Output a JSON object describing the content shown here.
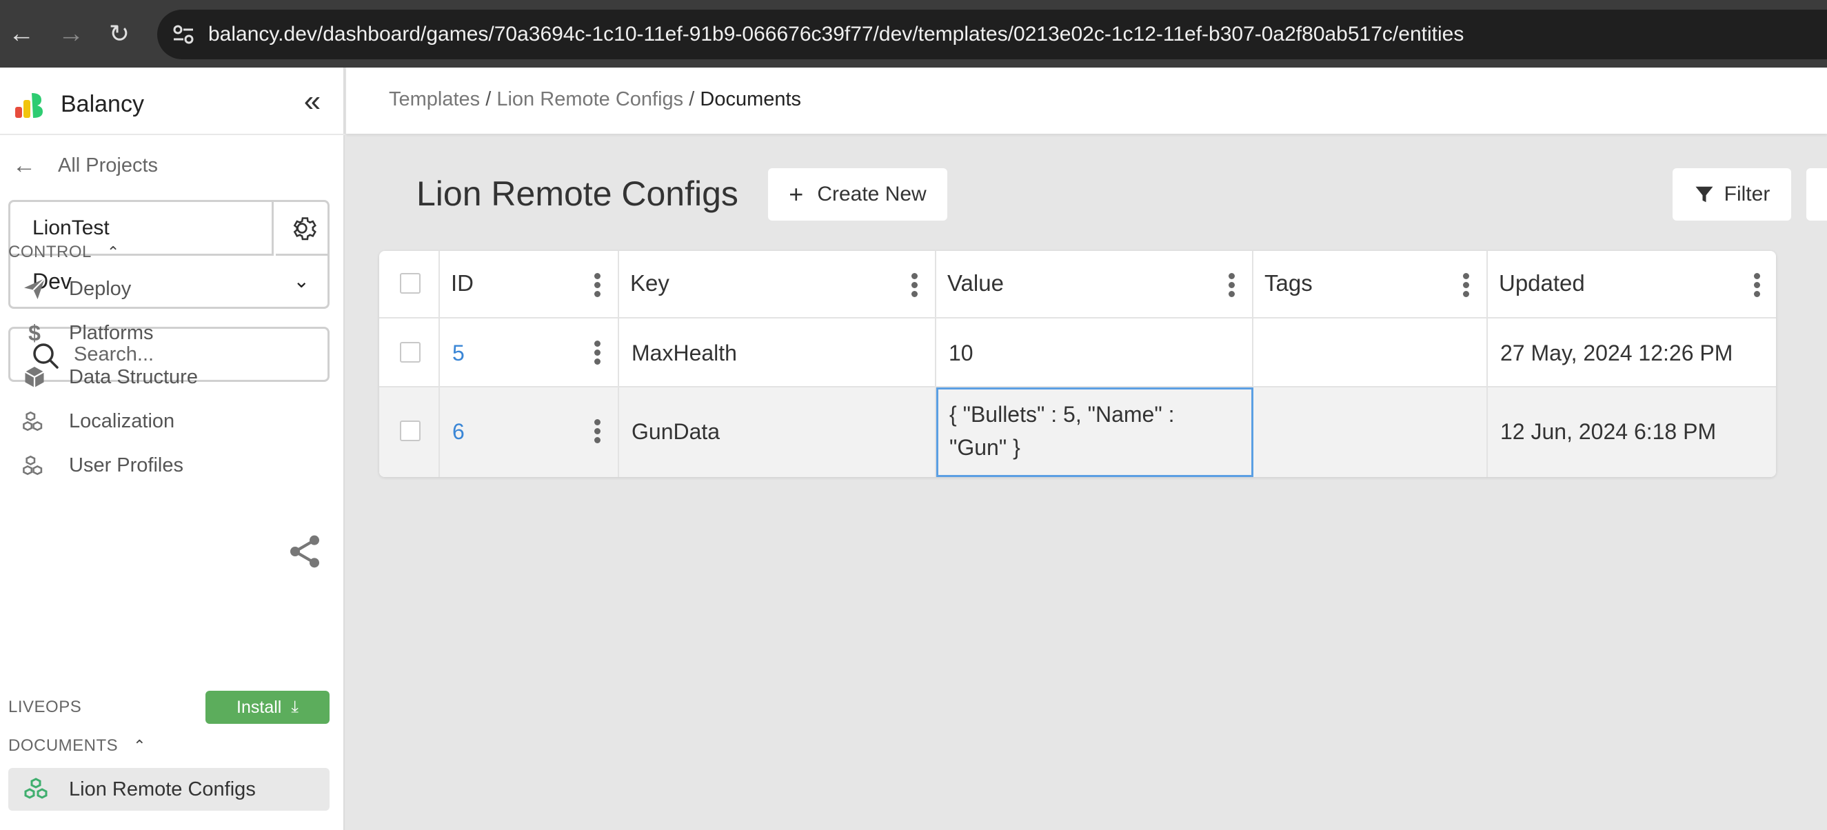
{
  "browser": {
    "url": "balancy.dev/dashboard/games/70a3694c-1c10-11ef-91b9-066676c39f77/dev/templates/0213e02c-1c12-11ef-b307-0a2f80ab517c/entities"
  },
  "sidebar": {
    "brand": "Balancy",
    "all_projects": "All Projects",
    "project_name": "LionTest",
    "environment": "Dev",
    "search_placeholder": "Search...",
    "control_section": "CONTROL",
    "control_items": [
      {
        "label": "Deploy",
        "icon": "paper-plane-icon"
      },
      {
        "label": "Platforms",
        "icon": "dollar-icon"
      },
      {
        "label": "Data Structure",
        "icon": "cube-icon"
      },
      {
        "label": "Localization",
        "icon": "cubes-icon"
      },
      {
        "label": "User Profiles",
        "icon": "cubes-icon"
      }
    ],
    "liveops_section": "LIVEOPS",
    "install_label": "Install",
    "documents_section": "DOCUMENTS",
    "documents_items": [
      {
        "label": "Lion Remote Configs",
        "icon": "cubes-icon",
        "active": true
      }
    ]
  },
  "header": {
    "breadcrumb": [
      "Templates",
      "Lion Remote Configs",
      "Documents"
    ],
    "separator": "/"
  },
  "main": {
    "title": "Lion Remote Configs",
    "create_new_label": "Create New",
    "filter_label": "Filter"
  },
  "table": {
    "columns": [
      "ID",
      "Key",
      "Value",
      "Tags",
      "Updated"
    ],
    "rows": [
      {
        "id": "5",
        "key": "MaxHealth",
        "value_line1": "10",
        "value_line2": "",
        "tags": "",
        "updated": "27 May, 2024 12:26 PM"
      },
      {
        "id": "6",
        "key": "GunData",
        "value_line1": "{ \"Bullets\" : 5, \"Name\" :",
        "value_line2": "\"Gun\" }",
        "tags": "",
        "updated": "12 Jun, 2024 6:18 PM"
      }
    ]
  },
  "colors": {
    "accent_blue": "#3a86d6",
    "install_green": "#5cad5c",
    "selection_border": "#5b9fe3"
  }
}
